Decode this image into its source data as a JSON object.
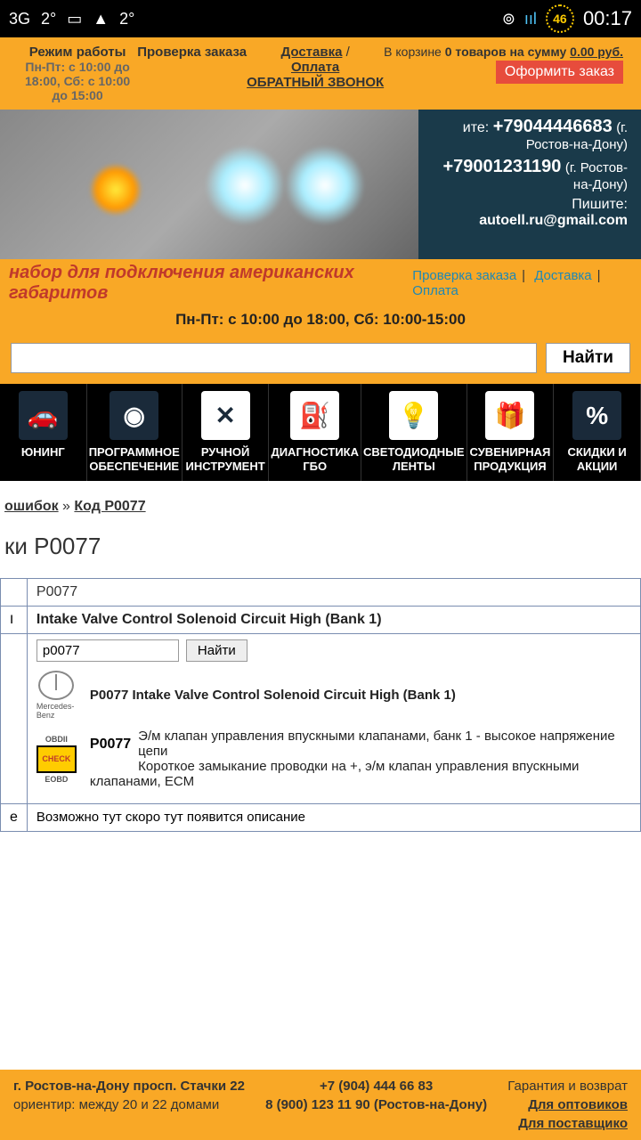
{
  "status": {
    "network": "3G",
    "temp1": "2°",
    "temp2": "2°",
    "battery": "46",
    "time": "00:17"
  },
  "top": {
    "work_mode": "Режим работы",
    "hours": "Пн-Пт: с 10:00 до 18:00, Сб: с 10:00 до 15:00",
    "order_check": "Проверка заказа",
    "delivery": "Доставка",
    "payment": "Оплата",
    "callback": "ОБРАТНЫЙ ЗВОНОК",
    "cart_prefix": "В корзине",
    "cart_items": "0 товаров на сумму",
    "cart_sum": "0.00 руб.",
    "order_btn": "Оформить заказ"
  },
  "contacts": {
    "call_label": "ите:",
    "phone1": "+79044446683",
    "city1": "(г. Ростов-на-Дону)",
    "phone2": "+79001231190",
    "city2": "(г. Ростов-на-Дону)",
    "write": "Пишите:",
    "email": "autoell.ru@gmail.com"
  },
  "promo": "набор для подключения американских габаритов",
  "strip": {
    "check": "Проверка заказа",
    "delivery": "Доставка",
    "payment": "Оплата"
  },
  "hours_banner": "Пн-Пт: с 10:00 до 18:00, Сб: 10:00-15:00",
  "search": {
    "btn": "Найти"
  },
  "cats": [
    {
      "label": "ЮНИНГ"
    },
    {
      "label": "ПРОГРАММНОЕ ОБЕСПЕЧЕНИЕ"
    },
    {
      "label": "РУЧНОЙ ИНСТРУМЕНТ"
    },
    {
      "label": "ДИАГНОСТИКА ГБО"
    },
    {
      "label": "СВЕТОДИОДНЫЕ ЛЕНТЫ"
    },
    {
      "label": "СУВЕНИРНАЯ ПРОДУКЦИЯ"
    },
    {
      "label": "СКИДКИ И АКЦИИ"
    }
  ],
  "breadcrumb": {
    "errors": "ошибок",
    "sep": " » ",
    "code": "Код P0077"
  },
  "title": "ки P0077",
  "table": {
    "code": "P0077",
    "desc_en": "Intake Valve Control Solenoid Circuit High (Bank 1)",
    "search_val": "p0077",
    "search_btn": "Найти",
    "mb_label": "Mercedes-Benz",
    "mb_text": "P0077 Intake Valve Control Solenoid Circuit High (Bank 1)",
    "obd_top": "OBDII",
    "obd_mid": "CHECK",
    "obd_bot": "EOBD",
    "obd_code": "P0077",
    "obd_line1": "Э/м клапан управления впускными клапанами, банк 1 - высокое напряжение цепи",
    "obd_line2": "Короткое замыкание проводки на +, э/м клапан управления впускными клапанами, ECM",
    "note_label": "е",
    "note": "Возможно тут скоро тут появится описание"
  },
  "footer": {
    "addr1": "г. Ростов-на-Дону просп. Стачки 22",
    "addr2": "ориентир: между 20 и 22 домами",
    "phone1": "+7 (904) 444 66 83",
    "phone2": "8 (900) 123 11 90 (Ростов-на-Дону)",
    "warranty": "Гарантия и возврат",
    "wholesale": "Для оптовиков",
    "suppliers": "Для поставщико"
  }
}
